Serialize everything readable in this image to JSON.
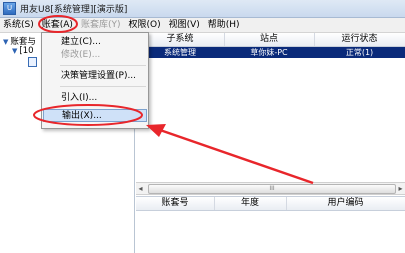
{
  "window": {
    "title": "用友U8[系统管理][演示版]"
  },
  "menubar": {
    "items": [
      {
        "label": "系统(S)",
        "state": "normal"
      },
      {
        "label": "账套(A)",
        "state": "active"
      },
      {
        "label": "账套库(Y)",
        "state": "disabled"
      },
      {
        "label": "权限(O)",
        "state": "normal"
      },
      {
        "label": "视图(V)",
        "state": "normal"
      },
      {
        "label": "帮助(H)",
        "state": "normal"
      }
    ]
  },
  "tree": {
    "root_label": "账套与",
    "child_label": "[10",
    "arrow_icon": "triangle-down"
  },
  "dropdown": {
    "items": [
      {
        "label": "建立(C)...",
        "state": "normal"
      },
      {
        "label": "修改(E)...",
        "state": "disabled"
      },
      {
        "label": "决策管理设置(P)...",
        "state": "normal"
      },
      {
        "label": "引入(I)...",
        "state": "normal"
      },
      {
        "label": "输出(X)...",
        "state": "hover"
      }
    ]
  },
  "grid": {
    "columns": [
      "子系统",
      "站点",
      "运行状态"
    ],
    "rows": [
      {
        "subsystem": "系统管理",
        "site": "草你妹-PC",
        "status": "正常(1)"
      }
    ]
  },
  "lower_grid": {
    "columns": [
      "账套号",
      "年度",
      "用户编码"
    ]
  },
  "scrollbar": {
    "thumb_mark": "III"
  },
  "annotation": {
    "color": "#e8262b"
  }
}
